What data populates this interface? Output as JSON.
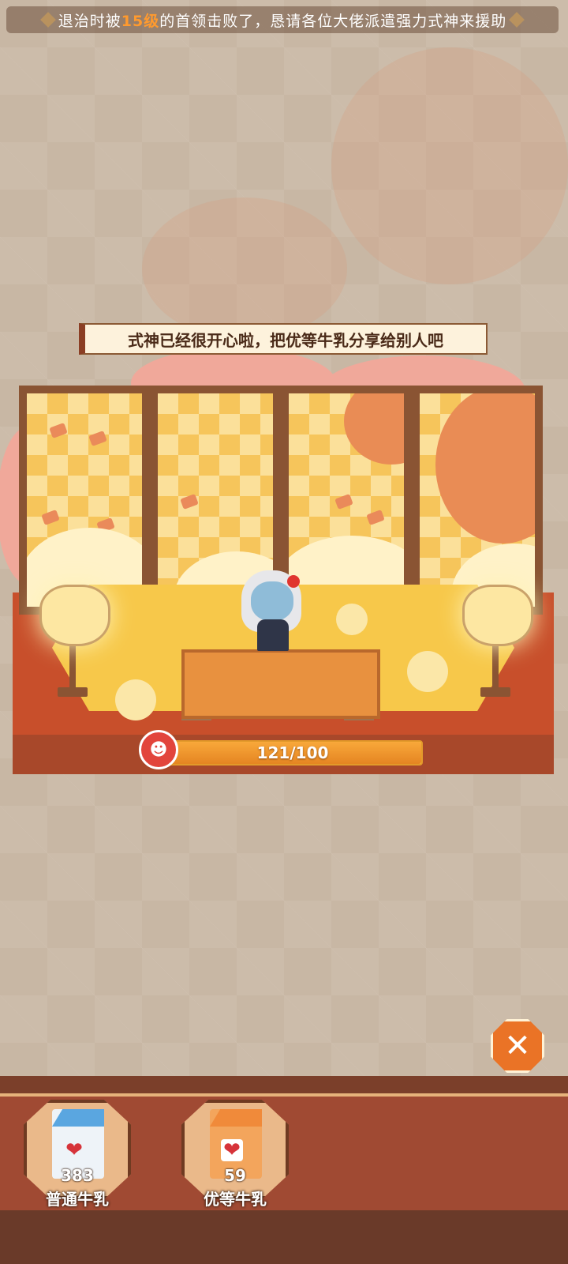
{
  "marquee": {
    "prefix": "退治时被",
    "level": "15级",
    "suffix": "的首领击败了，恳请各位大佬派遣强力式神来援助"
  },
  "hint_text": "式神已经很开心啦，把优等牛乳分享给别人吧",
  "affection": {
    "current": 121,
    "max": 100,
    "display": "121/100"
  },
  "items": [
    {
      "name": "普通牛乳",
      "count": "383",
      "color": "#5aa6e0"
    },
    {
      "name": "优等牛乳",
      "count": "59",
      "color": "#f08a3a"
    }
  ],
  "close_icon": "close-icon",
  "colors": {
    "accent": "#ea7326",
    "tray": "#a04a33",
    "bar": "#f6c444"
  }
}
